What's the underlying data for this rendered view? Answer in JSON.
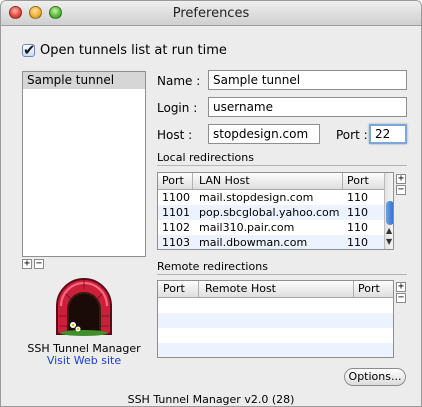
{
  "window": {
    "title": "Preferences"
  },
  "open_tunnels_checkbox": {
    "label": "Open tunnels list at run time",
    "checked": true
  },
  "tunnel_list": {
    "items": [
      "Sample tunnel"
    ]
  },
  "form": {
    "name_label": "Name :",
    "name_value": "Sample tunnel",
    "login_label": "Login :",
    "login_value": "username",
    "host_label": "Host :",
    "host_value": "stopdesign.com",
    "port_label": "Port :",
    "port_value": "22"
  },
  "local_redirections": {
    "section_label": "Local redirections",
    "columns": [
      "Port",
      "LAN Host",
      "Port"
    ],
    "rows": [
      [
        "1100",
        "mail.stopdesign.com",
        "110"
      ],
      [
        "1101",
        "pop.sbcglobal.yahoo.com",
        "110"
      ],
      [
        "1102",
        "mail310.pair.com",
        "110"
      ],
      [
        "1103",
        "mail.dbowman.com",
        "110"
      ]
    ]
  },
  "remote_redirections": {
    "section_label": "Remote redirections",
    "columns": [
      "Port",
      "Remote Host",
      "Port"
    ]
  },
  "app": {
    "name": "SSH Tunnel Manager",
    "website_link": "Visit Web site",
    "version": "SSH Tunnel Manager v2.0 (28)"
  },
  "buttons": {
    "options": "Options...",
    "add": "+",
    "remove": "−"
  },
  "icons": {
    "checkmark": "check-icon",
    "logo": "tunnel-logo-icon"
  },
  "colors": {
    "selection": "#d6d6d6",
    "link": "#1a3fd6",
    "focus": "#7ea7d9",
    "stripe": "#edf3fe"
  }
}
